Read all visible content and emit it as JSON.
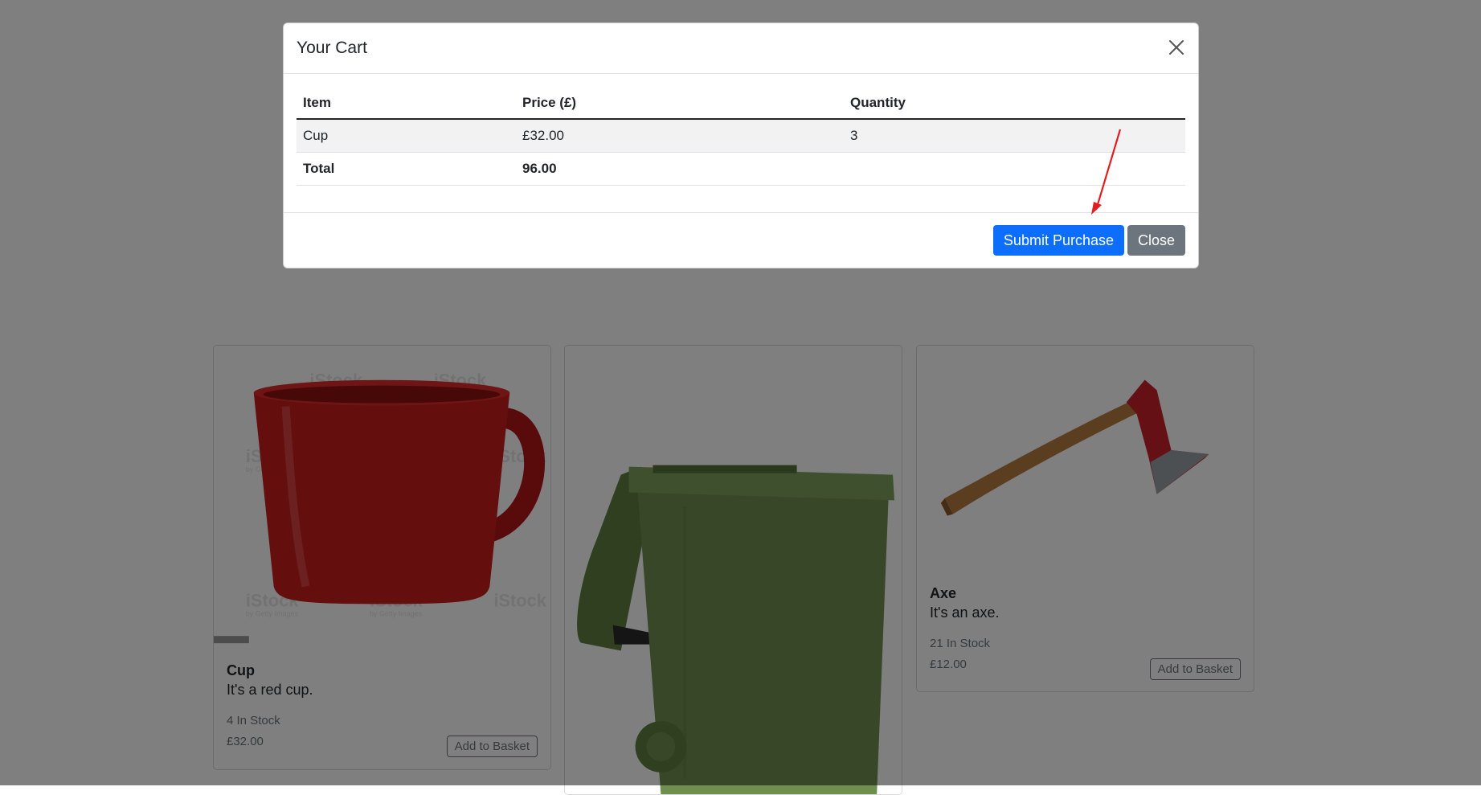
{
  "products": [
    {
      "name": "Cup",
      "description": "It's a red cup.",
      "stock": "4 In Stock",
      "price": "£32.00",
      "button": "Add to Basket",
      "image_watermark": "iStock",
      "image_watermark_sub": "by Getty Images"
    },
    {
      "name": "Bin"
    },
    {
      "name": "Axe",
      "description": "It's an axe.",
      "stock": "21 In Stock",
      "price": "£12.00",
      "button": "Add to Basket"
    }
  ],
  "modal": {
    "title": "Your Cart",
    "columns": [
      "Item",
      "Price (£)",
      "Quantity"
    ],
    "rows": [
      {
        "item": "Cup",
        "price": "£32.00",
        "quantity": "3"
      }
    ],
    "total_label": "Total",
    "total_value": "96.00",
    "submit_label": "Submit Purchase",
    "close_label": "Close"
  },
  "colors": {
    "primary": "#0d6efd",
    "secondary": "#6c757d",
    "cup": "#c81d1d",
    "bin": "#6f8f4e",
    "axe_head": "#c8202a",
    "axe_handle": "#b77a3e",
    "annotation": "#e02020"
  },
  "icons": {
    "close": "close-icon"
  }
}
